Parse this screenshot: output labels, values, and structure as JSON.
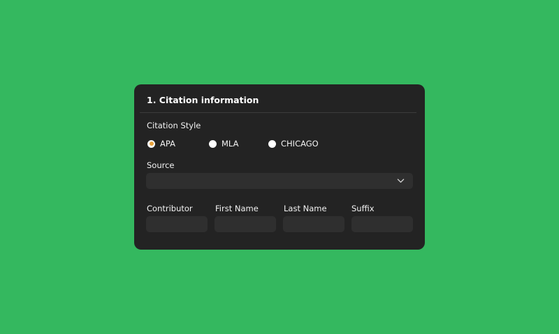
{
  "card": {
    "title": "1. Citation information",
    "citation_style_label": "Citation Style",
    "styles": [
      {
        "label": "APA",
        "selected": true
      },
      {
        "label": "MLA",
        "selected": false
      },
      {
        "label": "CHICAGO",
        "selected": false
      }
    ],
    "source_label": "Source",
    "source_value": "",
    "fields": [
      {
        "label": "Contributor",
        "value": ""
      },
      {
        "label": "First Name",
        "value": ""
      },
      {
        "label": "Last Name",
        "value": ""
      },
      {
        "label": "Suffix",
        "value": ""
      }
    ]
  },
  "colors": {
    "background": "#34b85f",
    "card": "#232323",
    "input": "#2f2f2f",
    "radio_accent": "#e9a23b"
  },
  "icons": {
    "dropdown": "chevron-down-icon"
  }
}
